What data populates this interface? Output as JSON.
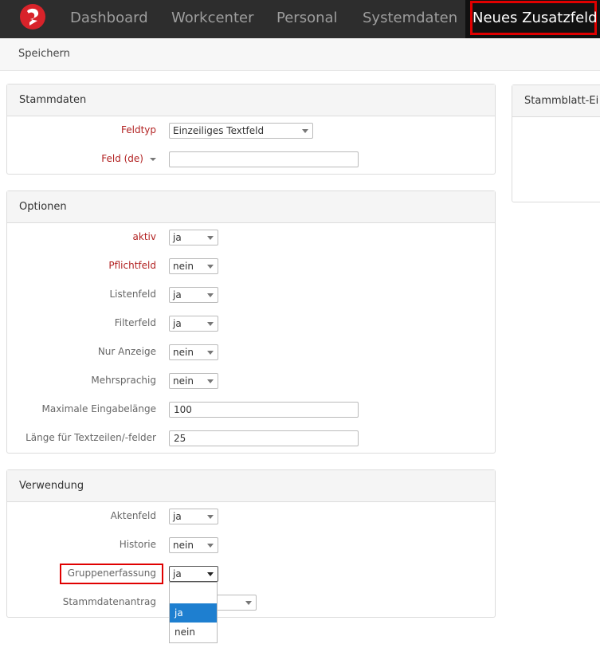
{
  "nav": {
    "items": [
      "Dashboard",
      "Workcenter",
      "Personal",
      "Systemdaten"
    ],
    "active": "Neues Zusatzfeld",
    "logo_icon": "logo-icon",
    "brand_color": "#d8232a"
  },
  "toolbar": {
    "save_label": "Speichern"
  },
  "stammdaten": {
    "title": "Stammdaten",
    "feldtyp_label": "Feldtyp",
    "feldtyp_value": "Einzeiliges Textfeld",
    "feld_label": "Feld (de)",
    "feld_value": ""
  },
  "optionen": {
    "title": "Optionen",
    "rows": [
      {
        "label": "aktiv",
        "value": "ja"
      },
      {
        "label": "Pflichtfeld",
        "value": "nein"
      },
      {
        "label": "Listenfeld",
        "value": "ja"
      },
      {
        "label": "Filterfeld",
        "value": "ja"
      },
      {
        "label": "Nur Anzeige",
        "value": "nein"
      },
      {
        "label": "Mehrsprachig",
        "value": "nein"
      }
    ],
    "maxlen_label": "Maximale Eingabelänge",
    "maxlen_value": "100",
    "textlen_label": "Länge für Textzeilen/-felder",
    "textlen_value": "25"
  },
  "verwendung": {
    "title": "Verwendung",
    "rows": [
      {
        "label": "Aktenfeld",
        "value": "ja"
      },
      {
        "label": "Historie",
        "value": "nein"
      },
      {
        "label": "Gruppenerfassung",
        "value": "ja"
      },
      {
        "label": "Stammdatenantrag",
        "value": ""
      }
    ],
    "dropdown_options": [
      "",
      "ja",
      "nein"
    ]
  },
  "stammblatt": {
    "title": "Stammblatt-Ei"
  },
  "colors": {
    "highlight": "#e00000",
    "required": "#b22222",
    "selected": "#1e7fd0"
  }
}
